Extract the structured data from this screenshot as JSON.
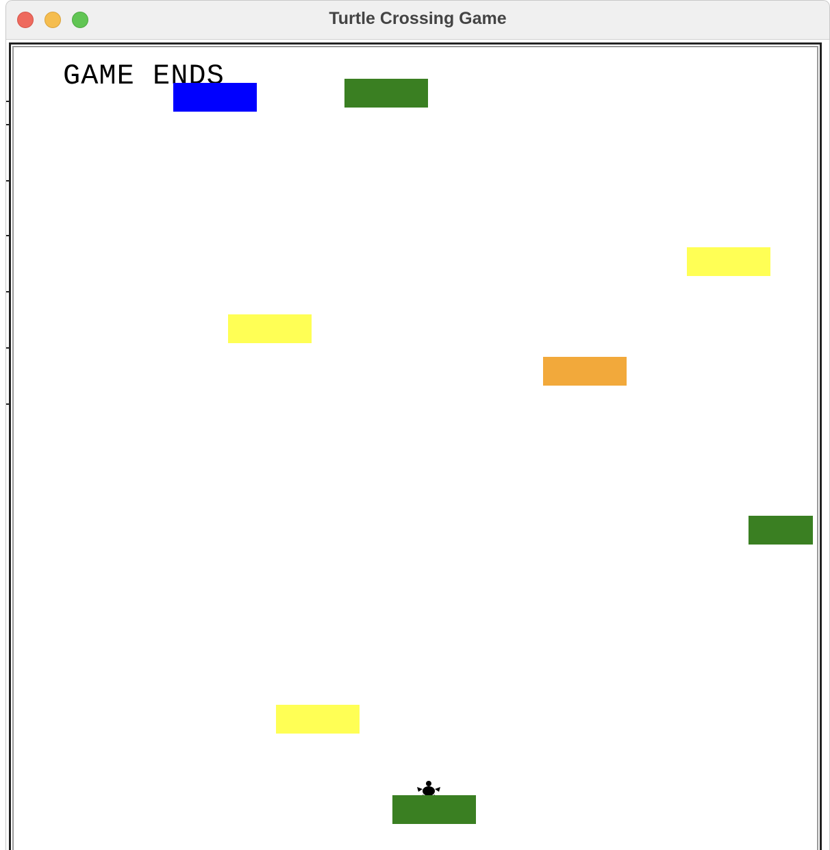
{
  "window": {
    "title": "Turtle Crossing Game"
  },
  "game": {
    "status_text": "GAME ENDS",
    "player": {
      "icon": "turtle-icon",
      "color": "#000000"
    },
    "cars": [
      {
        "name": "car-blue",
        "color": "#0000ff"
      },
      {
        "name": "car-green-top",
        "color": "#3a7f22"
      },
      {
        "name": "car-yellow-right",
        "color": "#ffff55"
      },
      {
        "name": "car-yellow-left",
        "color": "#ffff55"
      },
      {
        "name": "car-orange",
        "color": "#f2a93b"
      },
      {
        "name": "car-green-right",
        "color": "#3a7f22"
      },
      {
        "name": "car-yellow-bottom",
        "color": "#ffff55"
      },
      {
        "name": "car-green-bottom",
        "color": "#3a7f22"
      }
    ]
  }
}
